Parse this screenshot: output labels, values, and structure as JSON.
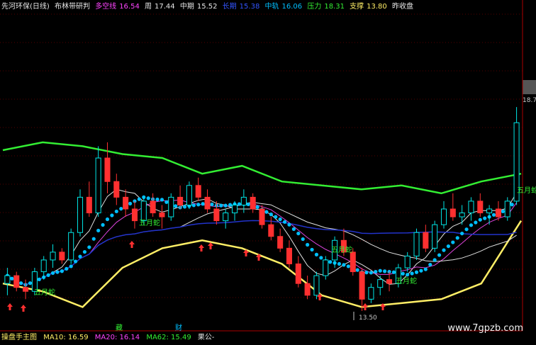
{
  "header": {
    "indicator_name": "先河环保(日线)",
    "formula_name": "布林带研判",
    "multi_label": "多空线",
    "multi_value": "16.54",
    "week_label": "周",
    "week_value": "17.44",
    "mid_label": "中期",
    "mid_value": "15.52",
    "long_label": "长期",
    "long_value": "15.38",
    "center_label": "中轨",
    "center_value": "16.06",
    "resist_label": "压力",
    "resist_value": "18.31",
    "support_label": "支撑",
    "support_value": "13.80",
    "prev_label": "昨收盘"
  },
  "footer": {
    "title": "操盘手主图",
    "ma10": "MA10: 16.59",
    "ma20": "MA20: 16.14",
    "ma62": "MA62: 15.49",
    "tail": "果公-"
  },
  "axis": {
    "high_label": "18.70",
    "low_label": "13.50"
  },
  "annotations": {
    "snake_label": "五月蛇",
    "bottom_char1": "藏",
    "bottom_char2": "财"
  },
  "watermark": "www.7gpzb.com",
  "colors": {
    "background": "#000000",
    "up_candle": "#00e5e5",
    "down_candle": "#ff3030",
    "upper_band": "#33ee33",
    "lower_band": "#ffee66",
    "dots": "#00bfff",
    "ma_magenta": "#dd44dd",
    "ma_white": "#e0e0e0",
    "ma_blue": "#2233cc",
    "grid": "#550000"
  },
  "chart_data": {
    "type": "candlestick",
    "title": "先河环保(日线)",
    "ylim": [
      13.3,
      18.9
    ],
    "markers": {
      "high": 18.7,
      "low": 13.5
    },
    "candles": [
      [
        14.2,
        14.6,
        13.9,
        14.4
      ],
      [
        14.4,
        14.5,
        14.0,
        14.1
      ],
      [
        14.1,
        14.3,
        13.8,
        14.0
      ],
      [
        14.0,
        14.6,
        13.9,
        14.5
      ],
      [
        14.5,
        14.9,
        14.3,
        14.8
      ],
      [
        14.8,
        15.2,
        14.6,
        15.0
      ],
      [
        15.0,
        15.1,
        14.7,
        14.8
      ],
      [
        14.8,
        15.6,
        14.7,
        15.5
      ],
      [
        15.5,
        16.6,
        15.4,
        16.4
      ],
      [
        16.4,
        16.8,
        15.9,
        16.0
      ],
      [
        16.0,
        17.7,
        15.9,
        17.4
      ],
      [
        17.4,
        17.8,
        16.5,
        16.8
      ],
      [
        16.8,
        17.0,
        16.2,
        16.4
      ],
      [
        16.4,
        16.6,
        15.9,
        16.1
      ],
      [
        16.1,
        16.3,
        15.6,
        15.8
      ],
      [
        15.8,
        16.4,
        15.7,
        16.3
      ],
      [
        16.3,
        16.5,
        15.9,
        16.0
      ],
      [
        16.0,
        16.2,
        15.6,
        15.9
      ],
      [
        15.9,
        16.5,
        15.8,
        16.4
      ],
      [
        16.4,
        16.7,
        16.1,
        16.2
      ],
      [
        16.2,
        16.8,
        16.1,
        16.7
      ],
      [
        16.7,
        16.9,
        16.3,
        16.4
      ],
      [
        16.4,
        16.6,
        16.0,
        16.1
      ],
      [
        16.1,
        16.3,
        15.7,
        15.8
      ],
      [
        15.8,
        16.1,
        15.6,
        16.0
      ],
      [
        16.0,
        16.3,
        15.8,
        16.2
      ],
      [
        16.2,
        16.6,
        16.0,
        16.4
      ],
      [
        16.4,
        16.5,
        16.0,
        16.1
      ],
      [
        16.1,
        16.2,
        15.6,
        15.7
      ],
      [
        15.7,
        15.9,
        15.3,
        15.4
      ],
      [
        15.4,
        15.6,
        15.0,
        15.1
      ],
      [
        15.1,
        15.3,
        14.6,
        14.7
      ],
      [
        14.7,
        14.9,
        14.1,
        14.2
      ],
      [
        14.2,
        14.4,
        13.8,
        13.9
      ],
      [
        13.9,
        14.5,
        13.8,
        14.4
      ],
      [
        14.4,
        14.9,
        14.3,
        14.8
      ],
      [
        14.8,
        15.4,
        14.6,
        15.3
      ],
      [
        15.3,
        15.6,
        14.9,
        15.0
      ],
      [
        15.0,
        15.1,
        14.4,
        14.5
      ],
      [
        14.5,
        14.6,
        13.5,
        13.8
      ],
      [
        13.8,
        14.2,
        13.7,
        14.1
      ],
      [
        14.1,
        14.4,
        13.9,
        14.3
      ],
      [
        14.3,
        14.5,
        14.0,
        14.2
      ],
      [
        14.2,
        14.7,
        14.1,
        14.6
      ],
      [
        14.6,
        15.0,
        14.5,
        14.9
      ],
      [
        14.9,
        15.6,
        14.8,
        15.5
      ],
      [
        15.5,
        15.7,
        15.0,
        15.1
      ],
      [
        15.1,
        15.8,
        15.0,
        15.7
      ],
      [
        15.7,
        16.3,
        15.6,
        16.1
      ],
      [
        16.1,
        16.5,
        15.8,
        15.9
      ],
      [
        15.9,
        16.2,
        15.7,
        16.0
      ],
      [
        16.0,
        16.4,
        15.8,
        16.3
      ],
      [
        16.3,
        16.5,
        15.9,
        16.0
      ],
      [
        16.0,
        16.2,
        15.7,
        16.1
      ],
      [
        16.1,
        16.3,
        15.8,
        15.9
      ],
      [
        15.9,
        16.4,
        15.8,
        16.3
      ],
      [
        16.3,
        18.7,
        16.2,
        18.3
      ]
    ],
    "upper_band_approx": [
      17.6,
      17.8,
      17.7,
      17.5,
      17.4,
      17.0,
      17.2,
      16.8,
      16.7,
      16.6,
      16.7,
      16.5,
      16.8,
      17.0
    ],
    "lower_band_approx": [
      14.2,
      14.0,
      13.6,
      14.6,
      15.1,
      15.3,
      15.1,
      14.7,
      13.9,
      13.6,
      13.7,
      13.8,
      14.2,
      15.8
    ]
  }
}
